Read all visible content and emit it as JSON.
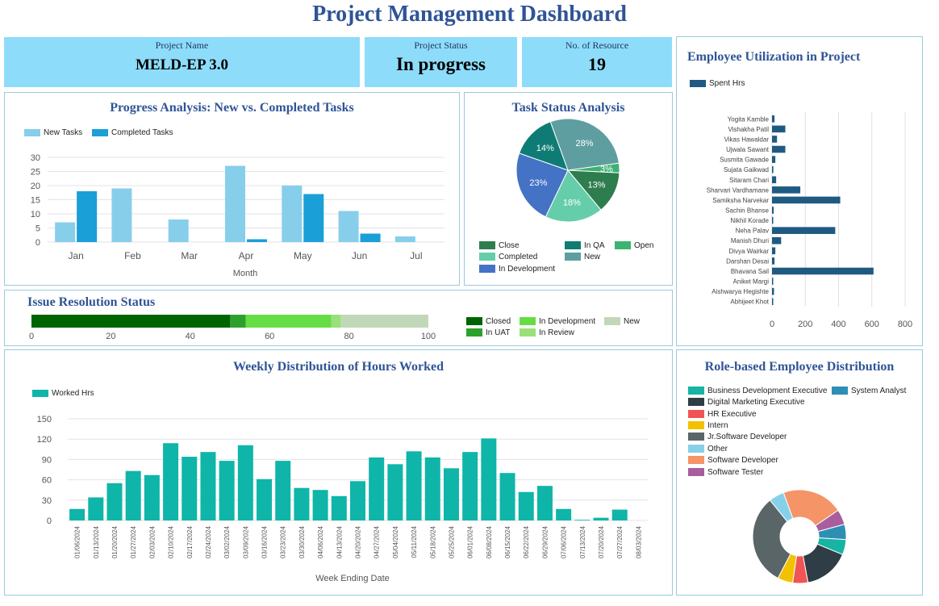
{
  "title": "Project Management Dashboard",
  "kpis": {
    "project_name_label": "Project Name",
    "project_name": "MELD-EP 3.0",
    "project_status_label": "Project Status",
    "project_status": "In progress",
    "resources_label": "No. of Resource",
    "resources": "19"
  },
  "panels": {
    "progress_title": "Progress Analysis: New vs. Completed Tasks",
    "task_status_title": "Task Status Analysis",
    "utilization_title": "Employee Utilization in Project",
    "issue_title": "Issue Resolution Status",
    "weekly_title": "Weekly Distribution of Hours Worked",
    "role_title": "Role-based Employee Distribution"
  },
  "chart_data": [
    {
      "id": "progress",
      "type": "bar",
      "title": "Progress Analysis: New vs. Completed Tasks",
      "xlabel": "Month",
      "categories": [
        "Jan",
        "Feb",
        "Mar",
        "Apr",
        "May",
        "Jun",
        "Jul"
      ],
      "series": [
        {
          "name": "New Tasks",
          "color": "#87ceeb",
          "values": [
            7,
            19,
            8,
            27,
            20,
            11,
            2
          ]
        },
        {
          "name": "Completed Tasks",
          "color": "#1a9fd6",
          "values": [
            18,
            0,
            0,
            1,
            17,
            3,
            0
          ]
        }
      ],
      "ylim": [
        0,
        30
      ],
      "yticks": [
        0,
        5,
        10,
        15,
        20,
        25,
        30
      ],
      "grid": true,
      "legend": "top-left"
    },
    {
      "id": "task_status",
      "type": "pie",
      "title": "Task Status Analysis",
      "slices": [
        {
          "name": "Close",
          "value": 13,
          "label": "13%",
          "color": "#2e7d4f"
        },
        {
          "name": "In QA",
          "value": 14,
          "label": "14%",
          "color": "#0e7c74"
        },
        {
          "name": "Open",
          "value": 3,
          "label": "3%",
          "color": "#3cb371"
        },
        {
          "name": "Completed",
          "value": 18,
          "label": "18%",
          "color": "#66cdaa"
        },
        {
          "name": "New",
          "value": 28,
          "label": "28%",
          "color": "#5f9ea0"
        },
        {
          "name": "In Development",
          "value": 23,
          "label": "23%",
          "color": "#4472c4"
        }
      ],
      "legend": "bottom"
    },
    {
      "id": "utilization",
      "type": "bar",
      "orientation": "horizontal",
      "title": "Employee Utilization in Project",
      "series_name": "Spent Hrs",
      "color": "#1f5a82",
      "categories": [
        "Yogita Kamble",
        "Vishakha Patil",
        "Vikas Hawaldar",
        "Ujwala Sawant",
        "Susmita Gawade",
        "Sujata Gaikwad",
        "Sitaram Chari",
        "Sharvari Vardhamane",
        "Samiksha Narvekar",
        "Sachin Bhanse",
        "Nikhil Korade",
        "Neha Palav",
        "Manish Dhuri",
        "Divya Wairkar",
        "Darshan Desai",
        "Bhavana Sail",
        "Aniket Margi",
        "Aishwarya Hegishte",
        "Abhijeet Khot"
      ],
      "values": [
        15,
        80,
        30,
        80,
        20,
        8,
        25,
        170,
        410,
        10,
        4,
        380,
        55,
        20,
        15,
        610,
        4,
        12,
        3
      ],
      "xlim": [
        0,
        800
      ],
      "xticks": [
        0,
        200,
        400,
        600,
        800
      ],
      "grid": true,
      "legend": "top-left"
    },
    {
      "id": "issue",
      "type": "bar",
      "orientation": "horizontal-stacked",
      "title": "Issue Resolution Status",
      "segments": [
        {
          "name": "Closed",
          "value": 50,
          "color": "#006400"
        },
        {
          "name": "In UAT",
          "value": 4,
          "color": "#2ca02c"
        },
        {
          "name": "In Development",
          "value": 21.5,
          "color": "#66dd44"
        },
        {
          "name": "In Review",
          "value": 2.5,
          "color": "#99e07a"
        },
        {
          "name": "New",
          "value": 22,
          "color": "#c1d8b8"
        }
      ],
      "xlim": [
        0,
        100
      ],
      "xticks": [
        0,
        20,
        40,
        60,
        80,
        100
      ],
      "legend": "right"
    },
    {
      "id": "weekly",
      "type": "bar",
      "title": "Weekly Distribution of Hours Worked",
      "xlabel": "Week Ending Date",
      "series_name": "Worked Hrs",
      "color": "#0fb5a8",
      "categories": [
        "01/06/2024",
        "01/13/2024",
        "01/20/2024",
        "01/27/2024",
        "02/03/2024",
        "02/10/2024",
        "02/17/2024",
        "02/24/2024",
        "03/02/2024",
        "03/09/2024",
        "03/16/2024",
        "03/23/2024",
        "03/30/2024",
        "04/06/2024",
        "04/13/2024",
        "04/20/2024",
        "04/27/2024",
        "05/04/2024",
        "05/11/2024",
        "05/18/2024",
        "05/25/2024",
        "06/01/2024",
        "06/08/2024",
        "06/15/2024",
        "06/22/2024",
        "06/29/2024",
        "07/06/2024",
        "07/13/2024",
        "07/20/2024",
        "07/27/2024",
        "08/03/2024"
      ],
      "values": [
        17,
        34,
        55,
        73,
        67,
        114,
        94,
        101,
        88,
        111,
        61,
        88,
        48,
        45,
        36,
        58,
        93,
        83,
        102,
        93,
        77,
        101,
        121,
        70,
        42,
        51,
        17,
        1,
        4,
        16
      ],
      "ylim": [
        0,
        150
      ],
      "yticks": [
        0,
        30,
        60,
        90,
        120,
        150
      ],
      "grid": true,
      "legend": "top-left"
    },
    {
      "id": "roles",
      "type": "pie",
      "variant": "donut",
      "title": "Role-based Employee Distribution",
      "slices": [
        {
          "name": "Business Development Executive",
          "value": 1,
          "color": "#17b3a3"
        },
        {
          "name": "System Analyst",
          "value": 1,
          "color": "#2e8fb5"
        },
        {
          "name": "Digital Marketing Executive",
          "value": 3,
          "color": "#2f3e46"
        },
        {
          "name": "HR Executive",
          "value": 1,
          "color": "#f05454"
        },
        {
          "name": "Intern",
          "value": 1,
          "color": "#f2c200"
        },
        {
          "name": "Jr.Software Developer",
          "value": 6,
          "color": "#5a6568"
        },
        {
          "name": "Other",
          "value": 1,
          "color": "#87d0ea"
        },
        {
          "name": "Software Developer",
          "value": 4,
          "color": "#f49467"
        },
        {
          "name": "Software Tester",
          "value": 1,
          "color": "#a85e9c"
        }
      ],
      "legend": "top"
    }
  ]
}
